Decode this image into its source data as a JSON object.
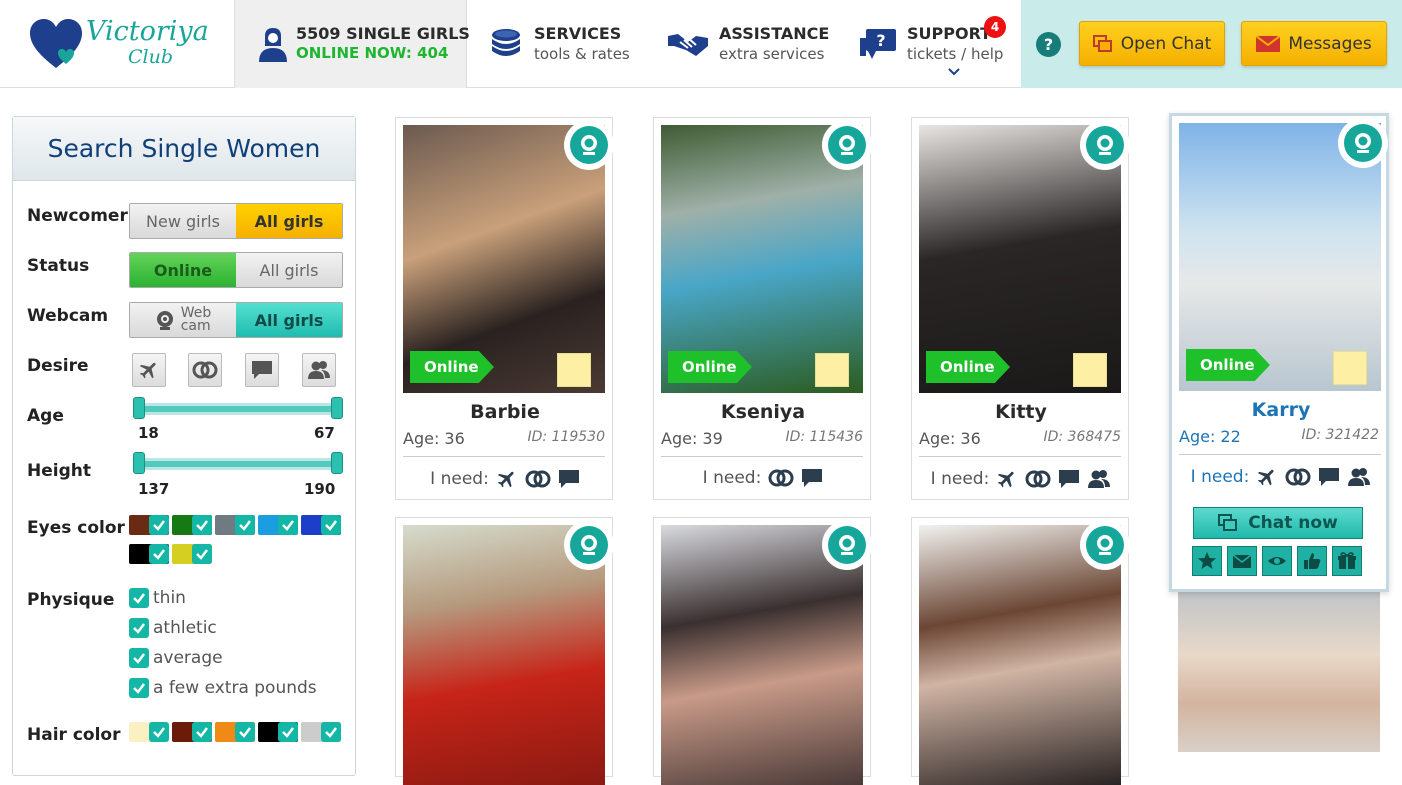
{
  "logo": {
    "line1": "Victoriya",
    "line2": "Club"
  },
  "nav": {
    "girls": {
      "title": "5509 SINGLE GIRLS",
      "online": "ONLINE NOW: 404"
    },
    "services": {
      "title": "SERVICES",
      "sub": "tools & rates"
    },
    "assistance": {
      "title": "ASSISTANCE",
      "sub": "extra services"
    },
    "support": {
      "title": "SUPPORT",
      "sub": "tickets / help",
      "badge": "4"
    }
  },
  "header_buttons": {
    "help": "?",
    "open_chat": "Open Chat",
    "messages": "Messages"
  },
  "search": {
    "title": "Search Single Women",
    "newcomer": {
      "label": "Newcomer",
      "opt1": "New girls",
      "opt2": "All girls"
    },
    "status": {
      "label": "Status",
      "opt1": "Online",
      "opt2": "All girls"
    },
    "webcam": {
      "label": "Webcam",
      "opt1a": "Web",
      "opt1b": "cam",
      "opt2": "All girls"
    },
    "desire": {
      "label": "Desire"
    },
    "age": {
      "label": "Age",
      "min": "18",
      "max": "67"
    },
    "height": {
      "label": "Height",
      "min": "137",
      "max": "190"
    },
    "eyes": {
      "label": "Eyes color"
    },
    "physique": {
      "label": "Physique",
      "options": [
        "thin",
        "athletic",
        "average",
        "a few extra pounds"
      ]
    },
    "hair": {
      "label": "Hair color"
    }
  },
  "colors": {
    "teal": "#16a79a",
    "orange": "#f5b000",
    "green": "#1ec12a",
    "navy": "#113f7a"
  },
  "cards": [
    {
      "name": "Barbie",
      "age": "Age: 36",
      "id": "ID: 119530",
      "need": "I need:",
      "status": "Online"
    },
    {
      "name": "Kseniya",
      "age": "Age: 39",
      "id": "ID: 115436",
      "need": "I need:",
      "status": "Online"
    },
    {
      "name": "Kitty",
      "age": "Age: 36",
      "id": "ID: 368475",
      "need": "I need:",
      "status": "Online"
    },
    {
      "name": "Karry",
      "age": "Age: 22",
      "id": "ID: 321422",
      "need": "I need:",
      "status": "Online",
      "chat": "Chat now"
    }
  ]
}
